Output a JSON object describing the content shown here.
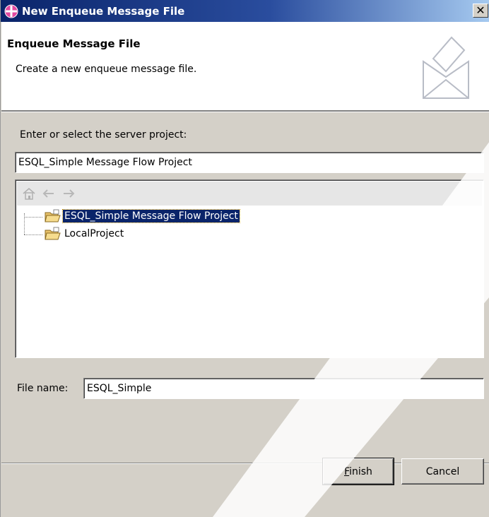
{
  "window": {
    "title": "New Enqueue Message File",
    "close_glyph": "✕"
  },
  "banner": {
    "title": "Enqueue Message File",
    "description": "Create a new enqueue message file.",
    "icon": "envelope-wizard-icon"
  },
  "server_project": {
    "label": "Enter or select the server project:",
    "value": "ESQL_Simple Message Flow Project"
  },
  "tree": {
    "toolbar_icons": [
      "home-icon",
      "back-arrow-icon",
      "forward-arrow-icon"
    ],
    "items": [
      {
        "label": "ESQL_Simple Message Flow Project",
        "selected": true,
        "icon": "project-folder-icon"
      },
      {
        "label": "LocalProject",
        "selected": false,
        "icon": "project-folder-icon"
      }
    ]
  },
  "file_name": {
    "label": "File name:",
    "value": "ESQL_Simple"
  },
  "buttons": {
    "finish": "Finish",
    "cancel": "Cancel"
  },
  "colors": {
    "titlebar": "#0a246a",
    "selection": "#0a246a",
    "dialog_bg": "#d4d0c8"
  }
}
